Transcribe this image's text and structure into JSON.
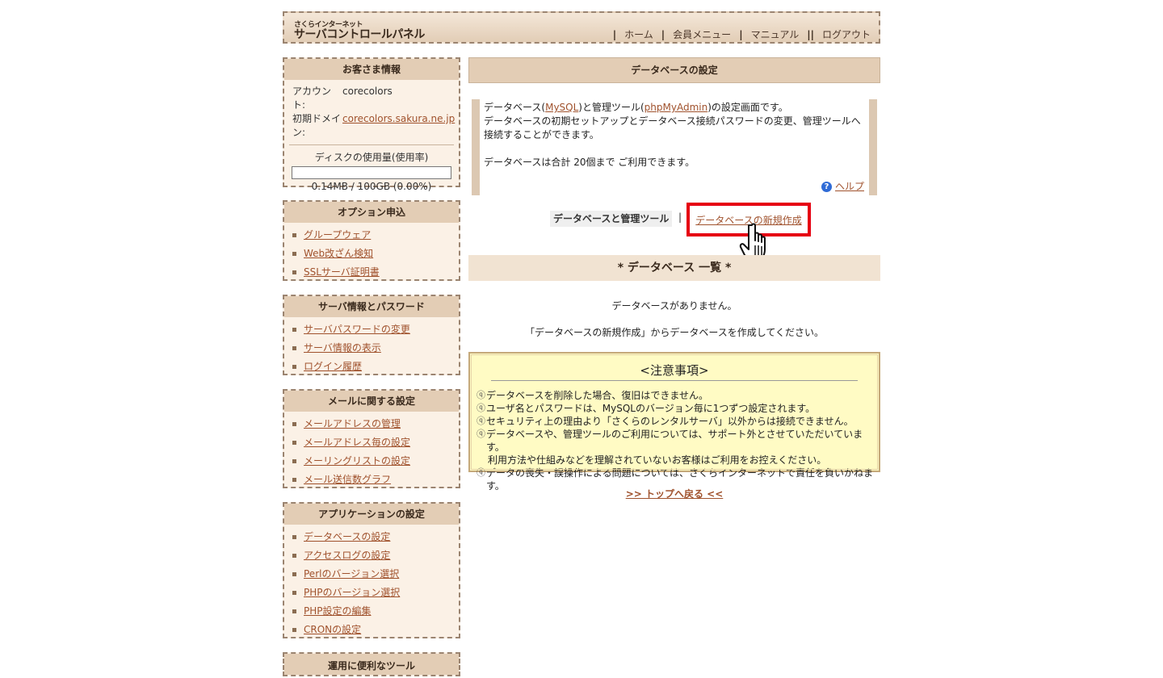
{
  "header": {
    "logo_small": "さくらインターネット",
    "logo_main": "サーバコントロールパネル",
    "nav": [
      "ホーム",
      "会員メニュー",
      "マニュアル",
      "ログアウト"
    ]
  },
  "customer": {
    "title": "お客さま情報",
    "account_label": "アカウント:",
    "account_value": "corecolors",
    "domain_label": "初期ドメイン:",
    "domain_value": "corecolors.sakura.ne.jp",
    "disk_label": "ディスクの使用量(使用率)",
    "disk_usage_text": "0.14MB / 100GB (0.00%)",
    "disk_fraction": 0.0
  },
  "sidebar": {
    "options": {
      "title": "オプション申込",
      "items": [
        "グループウェア",
        "Web改ざん検知",
        "SSLサーバ証明書"
      ]
    },
    "server": {
      "title": "サーバ情報とパスワード",
      "items": [
        "サーバパスワードの変更",
        "サーバ情報の表示",
        "ログイン履歴"
      ]
    },
    "mail": {
      "title": "メールに関する設定",
      "items": [
        "メールアドレスの管理",
        "メールアドレス毎の設定",
        "メーリングリストの設定",
        "メール送信数グラフ"
      ]
    },
    "apps": {
      "title": "アプリケーションの設定",
      "items": [
        "データベースの設定",
        "アクセスログの設定",
        "Perlのバージョン選択",
        "PHPのバージョン選択",
        "PHP設定の編集",
        "CRONの設定"
      ]
    },
    "tools": {
      "title": "運用に便利なツール"
    }
  },
  "main": {
    "title": "データベースの設定",
    "intro": {
      "line1_pre": "データベース(",
      "mysql": "MySQL",
      "line1_mid": ")と管理ツール(",
      "phpmyadmin": "phpMyAdmin",
      "line1_post": ")の設定画面です。",
      "line2": "データベースの初期セットアップとデータベース接続パスワードの変更、管理ツールへ接続することができます。",
      "line3": "データベースは合計 20個まで ご利用できます。",
      "help": "ヘルプ"
    },
    "tabs": {
      "current": "データベースと管理ツール",
      "separator": "|",
      "new": "データベースの新規作成"
    },
    "list_header": "* データベース 一覧 *",
    "empty": "データベースがありません。",
    "empty_hint": "「データベースの新規作成」からデータベースを作成してください。",
    "notice": {
      "title": "<注意事項>",
      "items": [
        "データベースを削除した場合、復旧はできません。",
        "ユーザ名とパスワードは、MySQLのバージョン毎に1つずつ設定されます。",
        "セキュリティ上の理由より「さくらのレンタルサーバ」以外からは接続できません。",
        "データベースや、管理ツールのご利用については、サポート外とさせていただいています。",
        "データの喪失・誤操作による問題については、さくらインターネットで責任を負いかねます。"
      ],
      "continuation": "利用方法や仕組みなどを理解されていないお客様はご利用をお控えください。"
    },
    "back": ">> トップへ戻る <<"
  },
  "colors": {
    "accent": "#a0522d",
    "highlight_border": "#e60012",
    "panel": "#e3cdb5"
  }
}
